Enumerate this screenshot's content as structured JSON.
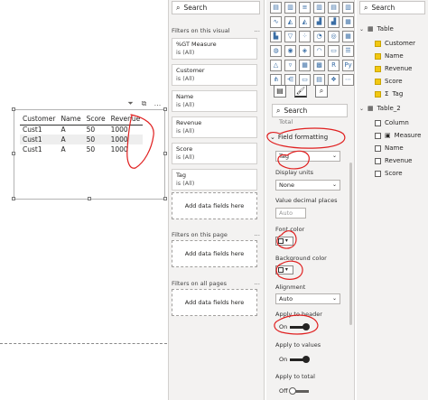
{
  "table_visual": {
    "headers": [
      "Customer",
      "Name",
      "Score",
      "Revenue"
    ],
    "rows": [
      [
        "Cust1",
        "A",
        "50",
        "1000"
      ],
      [
        "Cust1",
        "A",
        "50",
        "1000"
      ],
      [
        "Cust1",
        "A",
        "50",
        "1000"
      ]
    ]
  },
  "filters": {
    "search_placeholder": "Search",
    "on_visual_title": "Filters on this visual",
    "cards": [
      {
        "name": "%GT Measure",
        "value": "is (All)"
      },
      {
        "name": "Customer",
        "value": "is (All)"
      },
      {
        "name": "Name",
        "value": "is (All)"
      },
      {
        "name": "Revenue",
        "value": "is (All)"
      },
      {
        "name": "Score",
        "value": "is (All)"
      },
      {
        "name": "Tag",
        "value": "is (All)"
      }
    ],
    "add_data_fields": "Add data fields here",
    "on_page_title": "Filters on this page",
    "on_all_pages_title": "Filters on all pages",
    "more": "..."
  },
  "visualizations": {
    "search_placeholder": "Search",
    "partial_label": "Total",
    "field_formatting": "Field formatting",
    "field_select": "Tag",
    "display_units_label": "Display units",
    "display_units_value": "None",
    "decimal_label": "Value decimal places",
    "decimal_placeholder": "Auto",
    "font_color_label": "Font color",
    "background_color_label": "Background color",
    "alignment_label": "Alignment",
    "alignment_value": "Auto",
    "apply_header_label": "Apply to header",
    "apply_header_state": "On",
    "apply_values_label": "Apply to values",
    "apply_values_state": "On",
    "apply_total_label": "Apply to total",
    "apply_total_state": "Off",
    "icons": [
      "R",
      "Py"
    ]
  },
  "fields": {
    "search_placeholder": "Search",
    "tables": [
      {
        "name": "Table",
        "items": [
          {
            "label": "Customer",
            "checked": true
          },
          {
            "label": "Name",
            "checked": true
          },
          {
            "label": "Revenue",
            "checked": true
          },
          {
            "label": "Score",
            "checked": true
          },
          {
            "label": "Tag",
            "checked": true,
            "sigma": true
          }
        ]
      },
      {
        "name": "Table_2",
        "items": [
          {
            "label": "Column",
            "checked": false
          },
          {
            "label": "Measure",
            "checked": false
          },
          {
            "label": "Name",
            "checked": false
          },
          {
            "label": "Revenue",
            "checked": false
          },
          {
            "label": "Score",
            "checked": false
          }
        ]
      }
    ],
    "sigma": "Σ"
  }
}
